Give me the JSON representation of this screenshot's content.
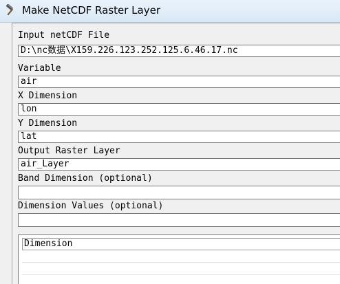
{
  "window": {
    "title": "Make NetCDF Raster Layer",
    "icon": "hammer-icon"
  },
  "form": {
    "input_netcdf_label": "Input netCDF File",
    "input_netcdf_value": "D:\\nc数据\\X159.226.123.252.125.6.46.17.nc",
    "variable_label": "Variable",
    "variable_value": "air",
    "x_dimension_label": "X Dimension",
    "x_dimension_value": "lon",
    "y_dimension_label": "Y Dimension",
    "y_dimension_value": "lat",
    "output_layer_label": "Output Raster Layer",
    "output_layer_value": "air_Layer",
    "band_dimension_label": "Band Dimension (optional)",
    "band_dimension_value": "",
    "dimension_values_label": "Dimension Values (optional)"
  },
  "dimension_table": {
    "header": "Dimension"
  }
}
